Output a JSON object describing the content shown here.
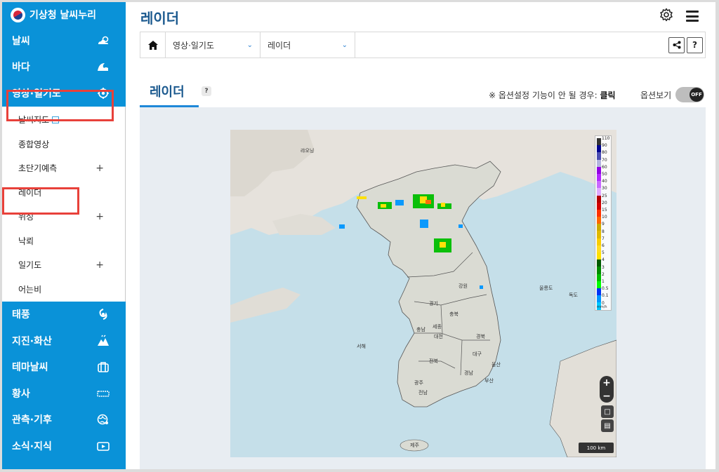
{
  "brand": {
    "name": "기상청 날씨누리"
  },
  "sidebar": {
    "items": [
      {
        "label": "날씨",
        "icon": "weather-icon"
      },
      {
        "label": "바다",
        "icon": "wave-icon"
      },
      {
        "label": "영상·일기도",
        "icon": "satellite-target-icon"
      }
    ],
    "sub_items": [
      {
        "label": "날씨지도",
        "external": true
      },
      {
        "label": "종합영상"
      },
      {
        "label": "초단기예측",
        "expand": "+"
      },
      {
        "label": "레이더"
      },
      {
        "label": "위성",
        "expand": "+"
      },
      {
        "label": "낙뢰"
      },
      {
        "label": "일기도",
        "expand": "+"
      },
      {
        "label": "어는비"
      }
    ],
    "items_after": [
      {
        "label": "태풍",
        "icon": "typhoon-icon"
      },
      {
        "label": "지진·화산",
        "icon": "earthquake-icon"
      },
      {
        "label": "테마날씨",
        "icon": "briefcase-icon"
      },
      {
        "label": "황사",
        "icon": "dust-icon"
      },
      {
        "label": "관측·기후",
        "icon": "globe-icon"
      },
      {
        "label": "소식·지식",
        "icon": "video-icon"
      }
    ]
  },
  "header": {
    "title": "레이더"
  },
  "breadcrumb": {
    "level1": "영상·일기도",
    "level2": "레이더",
    "share": "<",
    "help": "?"
  },
  "tabs": {
    "active": "레이더",
    "help": "?"
  },
  "options": {
    "note_prefix": "※ 옵션설정 기능이 안 될 경우:",
    "note_action": "클릭",
    "toggle_label": "옵션보기",
    "toggle_state": "OFF"
  },
  "map": {
    "labels": {
      "laoyang": "랴오닝",
      "gangwon": "강원",
      "gyeonggi": "경기",
      "chungbuk": "충북",
      "chungnam": "충남",
      "daejeon": "대전",
      "sejong": "세종",
      "jeonbuk": "전북",
      "gyeongbuk": "경북",
      "daegu": "대구",
      "gyeongnam": "경남",
      "ulsan": "울산",
      "busan": "부산",
      "gwangju": "광주",
      "jeonnam": "전남",
      "jeju": "제주",
      "ulleung": "울릉도",
      "dokdo": "독도",
      "westsea": "서해"
    },
    "legend": {
      "values": [
        "110",
        "90",
        "80",
        "70",
        "60",
        "50",
        "40",
        "30",
        "25",
        "20",
        "15",
        "10",
        "9",
        "8",
        "7",
        "6",
        "5",
        "4",
        "3",
        "2",
        "1",
        "0.5",
        "0.1",
        "0"
      ],
      "colors": [
        "#333333",
        "#000390",
        "#4c4eb1",
        "#b3b4de",
        "#9300e4",
        "#b329ff",
        "#c969ff",
        "#e0a9ff",
        "#b40000",
        "#d20000",
        "#ff3200",
        "#ff6600",
        "#ccaa00",
        "#e0b900",
        "#f9cd00",
        "#ffdc1f",
        "#ffe100",
        "#005a00",
        "#008c00",
        "#00be00",
        "#00ff00",
        "#0033f5",
        "#0096ff",
        "#00c8ff"
      ],
      "unit": "mm/h"
    },
    "zoom_in": "+",
    "zoom_out": "−",
    "scale": "100 km"
  }
}
